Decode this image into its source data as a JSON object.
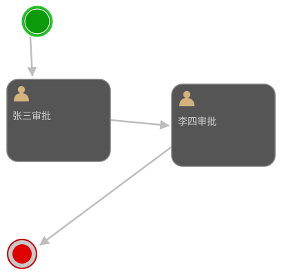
{
  "diagram": {
    "tasks": [
      {
        "id": "task-zhangsan",
        "label": "张三审批",
        "icon": "user-icon"
      },
      {
        "id": "task-lisi",
        "label": "李四审批",
        "icon": "user-icon"
      }
    ],
    "start_event": {
      "icon": "start-event-icon"
    },
    "end_event": {
      "icon": "end-event-icon"
    },
    "colors": {
      "task_fill": "#555555",
      "task_stroke": "#808080",
      "label": "#cfcfcf",
      "user_icon": "#d4b37c",
      "start_fill": "#0a9a0a",
      "start_stroke": "#28c228",
      "end_fill": "#e00000",
      "end_ring": "#c8c8c8",
      "end_stroke": "#c00000",
      "flow": "#bdbdbd"
    }
  }
}
